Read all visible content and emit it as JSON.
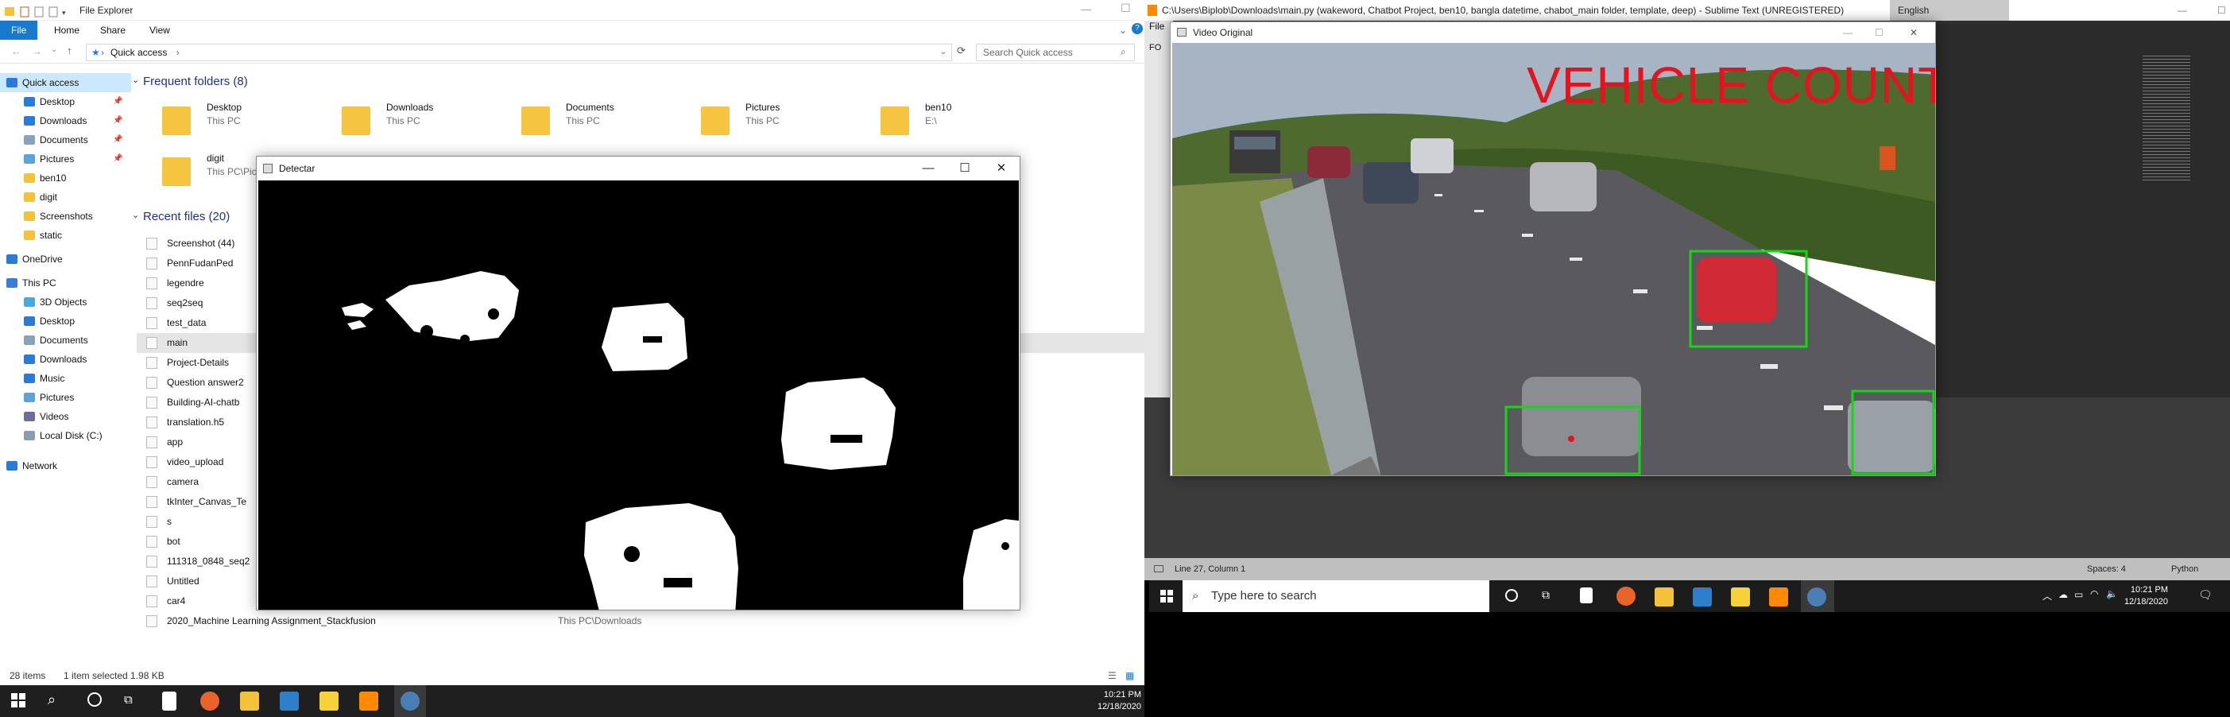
{
  "explorer": {
    "title": "File Explorer",
    "ribbon_tabs": [
      "File",
      "Home",
      "Share",
      "View"
    ],
    "address": "Quick access",
    "search_placeholder": "Search Quick access",
    "nav_items": [
      {
        "label": "Quick access",
        "icon": "star-icon",
        "color": "#2b7bd6",
        "selected": true
      },
      {
        "label": "Desktop",
        "icon": "desktop-icon",
        "color": "#2b7bd6",
        "pinned": true
      },
      {
        "label": "Downloads",
        "icon": "download-icon",
        "color": "#2b7bd6",
        "pinned": true
      },
      {
        "label": "Documents",
        "icon": "documents-icon",
        "color": "#8aa2bb",
        "pinned": true
      },
      {
        "label": "Pictures",
        "icon": "pictures-icon",
        "color": "#5ba3d9",
        "pinned": true
      },
      {
        "label": "ben10",
        "icon": "folder-icon",
        "color": "#f3c13a"
      },
      {
        "label": "digit",
        "icon": "folder-icon",
        "color": "#f3c13a"
      },
      {
        "label": "Screenshots",
        "icon": "folder-icon",
        "color": "#f3c13a"
      },
      {
        "label": "static",
        "icon": "folder-icon",
        "color": "#f3c13a"
      },
      {
        "label": "OneDrive",
        "icon": "cloud-icon",
        "color": "#2b7bd6"
      },
      {
        "label": "This PC",
        "icon": "pc-icon",
        "color": "#3a7bd5"
      },
      {
        "label": "3D Objects",
        "icon": "cube-icon",
        "color": "#4aa8e0"
      },
      {
        "label": "Desktop",
        "icon": "desktop-icon",
        "color": "#2b7bd6"
      },
      {
        "label": "Documents",
        "icon": "documents-icon",
        "color": "#8aa2bb"
      },
      {
        "label": "Downloads",
        "icon": "download-icon",
        "color": "#2b7bd6"
      },
      {
        "label": "Music",
        "icon": "music-icon",
        "color": "#2b7bd6"
      },
      {
        "label": "Pictures",
        "icon": "pictures-icon",
        "color": "#5ba3d9"
      },
      {
        "label": "Videos",
        "icon": "videos-icon",
        "color": "#6d6d9b"
      },
      {
        "label": "Local Disk (C:)",
        "icon": "disk-icon",
        "color": "#8b9bb0"
      },
      {
        "label": "Network",
        "icon": "network-icon",
        "color": "#2b7bd6"
      }
    ],
    "frequent_header": "Frequent folders (8)",
    "frequent": [
      {
        "name": "Desktop",
        "loc": "This PC"
      },
      {
        "name": "Downloads",
        "loc": "This PC"
      },
      {
        "name": "Documents",
        "loc": "This PC"
      },
      {
        "name": "Pictures",
        "loc": "This PC"
      },
      {
        "name": "ben10",
        "loc": "E:\\"
      },
      {
        "name": "digit",
        "loc": "This PC\\Pictures"
      }
    ],
    "recent_header": "Recent files (20)",
    "recent": [
      {
        "name": "Screenshot (44)"
      },
      {
        "name": "PennFudanPed"
      },
      {
        "name": "legendre"
      },
      {
        "name": "seq2seq"
      },
      {
        "name": "test_data"
      },
      {
        "name": "main",
        "selected": true
      },
      {
        "name": "Project-Details"
      },
      {
        "name": "Question answer2"
      },
      {
        "name": "Building-AI-chatb"
      },
      {
        "name": "translation.h5"
      },
      {
        "name": "app"
      },
      {
        "name": "video_upload"
      },
      {
        "name": "camera"
      },
      {
        "name": "tkInter_Canvas_Te"
      },
      {
        "name": "s"
      },
      {
        "name": "bot"
      },
      {
        "name": "111318_0848_seq2"
      },
      {
        "name": "Untitled"
      },
      {
        "name": "car4"
      },
      {
        "name": "2020_Machine Learning Assignment_Stackfusion",
        "path": "This PC\\Downloads"
      }
    ],
    "status": {
      "count": "28 items",
      "selection": "1 item selected  1.98 KB"
    }
  },
  "detector_window": {
    "title": "Detectar"
  },
  "video_window": {
    "title": "Video Original",
    "overlay_text": "VEHICLE  COUNT",
    "overlay_color": "#e3141f",
    "box_color": "#14d614"
  },
  "sublime": {
    "title": "C:\\Users\\Biplob\\Downloads\\main.py (wakeword, Chatbot Project, ben10, bangla datetime, chabot_main folder, template, deep) - Sublime Text (UNREGISTERED)",
    "menu_first": "File",
    "sidebar_label": "FO",
    "language_label": "English",
    "status_left": "Line 27, Column 1",
    "status_spaces": "Spaces: 4",
    "status_syntax": "Python"
  },
  "taskbar_left": {
    "time": "10:21 PM",
    "date": "12/18/2020"
  },
  "taskbar_right": {
    "search_placeholder": "Type here to search",
    "time": "10:21 PM",
    "date": "12/18/2020"
  }
}
